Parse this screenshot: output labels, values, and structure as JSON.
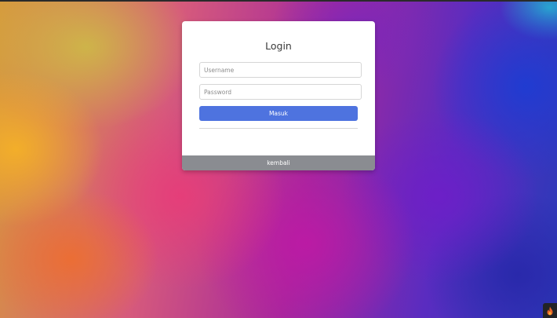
{
  "login_card": {
    "title": "Login",
    "username_placeholder": "Username",
    "password_placeholder": "Password",
    "submit_label": "Masuk",
    "back_label": "kembali"
  },
  "colors": {
    "submit_button": "#4e73df",
    "back_bar": "#8a8c91",
    "card_background": "#ffffff"
  },
  "corner_badge": {
    "icon": "flame-icon"
  }
}
